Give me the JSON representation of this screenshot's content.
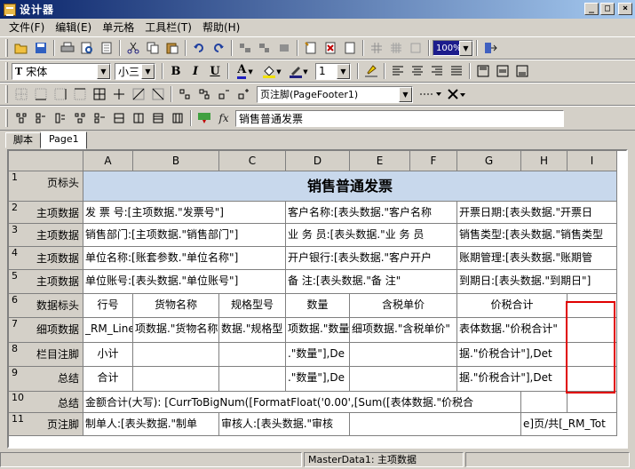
{
  "window": {
    "title": "设计器",
    "btn_min": "_",
    "btn_max": "□",
    "btn_close": "×"
  },
  "menu": [
    "文件(F)",
    "编辑(E)",
    "单元格",
    "工具栏(T)",
    "帮助(H)"
  ],
  "format": {
    "font_name": "宋体",
    "font_size": "小三",
    "line_width": "1"
  },
  "band_select": "页注脚(PageFooter1)",
  "formula": {
    "fx_label": "fx",
    "value": "销售普通发票"
  },
  "tabs": [
    "脚本",
    "Page1"
  ],
  "grid": {
    "columns": [
      "A",
      "B",
      "C",
      "D",
      "E",
      "F",
      "G",
      "H",
      "I"
    ],
    "rows": [
      {
        "num": "1",
        "name": "页标头"
      },
      {
        "num": "2",
        "name": "主项数据"
      },
      {
        "num": "3",
        "name": "主项数据"
      },
      {
        "num": "4",
        "name": "主项数据"
      },
      {
        "num": "5",
        "name": "主项数据"
      },
      {
        "num": "6",
        "name": "数据标头"
      },
      {
        "num": "7",
        "name": "细项数据"
      },
      {
        "num": "8",
        "name": "栏目注脚"
      },
      {
        "num": "9",
        "name": "总结"
      },
      {
        "num": "10",
        "name": "总结"
      },
      {
        "num": "11",
        "name": "页注脚"
      }
    ],
    "report_title": "销售普通发票",
    "r2": [
      "发 票 号:[主项数据.\"发票号\"]",
      "客户名称:[表头数据.\"客户名称",
      "开票日期:[表头数据.\"开票日"
    ],
    "r3": [
      "销售部门:[主项数据.\"销售部门\"]",
      "业 务 员:[表头数据.\"业 务 员",
      "销售类型:[表头数据.\"销售类型"
    ],
    "r4": [
      "单位名称:[账套参数.\"单位名称\"]",
      "开户银行:[表头数据.\"客户开户",
      "账期管理:[表头数据.\"账期管"
    ],
    "r5": [
      "单位账号:[表头数据.\"单位账号\"]",
      "备   注:[表头数据.\"备   注\"",
      "到期日:[表头数据.\"到期日\"]"
    ],
    "r6": [
      "行号",
      "货物名称",
      "规格型号",
      "数量",
      "含税单价",
      "价税合计"
    ],
    "r7": [
      "_RM_Line",
      "项数据.\"货物名称",
      "数据.\"规格型",
      "项数据.\"数量",
      "细项数据.\"含税单价\"",
      "表体数据.\"价税合计\""
    ],
    "r8": [
      "小计",
      ".\"数量\"],De",
      "据.\"价税合计\"],Det"
    ],
    "r9": [
      "合计",
      ".\"数量\"],De",
      "据.\"价税合计\"],Det"
    ],
    "r10": "金额合计(大写): [CurrToBigNum([FormatFloat('0.00',[Sum([表体数据.\"价税合",
    "r11": [
      "制单人:[表头数据.\"制单",
      "审核人:[表头数据.\"审核",
      "e]页/共[_RM_Tot"
    ]
  },
  "status": {
    "panel2": "MasterData1: 主项数据"
  },
  "icons": [
    "open-folder-icon",
    "save-icon",
    "print-icon",
    "print-preview-icon",
    "cut-icon",
    "copy-icon",
    "paste-icon",
    "undo-icon",
    "redo-icon",
    "align-icon",
    "insert-page-icon",
    "grid-icon",
    "zoom-icon",
    "exit-icon",
    "bold-icon",
    "italic-icon",
    "underline-icon",
    "font-color-icon",
    "fill-color-icon",
    "pen-color-icon",
    "highlighter-icon",
    "align-left-icon",
    "align-center-icon",
    "align-right-icon",
    "justify-icon",
    "border-icon",
    "close-cross-icon",
    "confirm-icon",
    "function-icon"
  ],
  "zoom": "100%",
  "colors": {
    "title_row": "#c8d8ec",
    "highlight_box": "#e00000",
    "titlebar_start": "#0a246a"
  }
}
